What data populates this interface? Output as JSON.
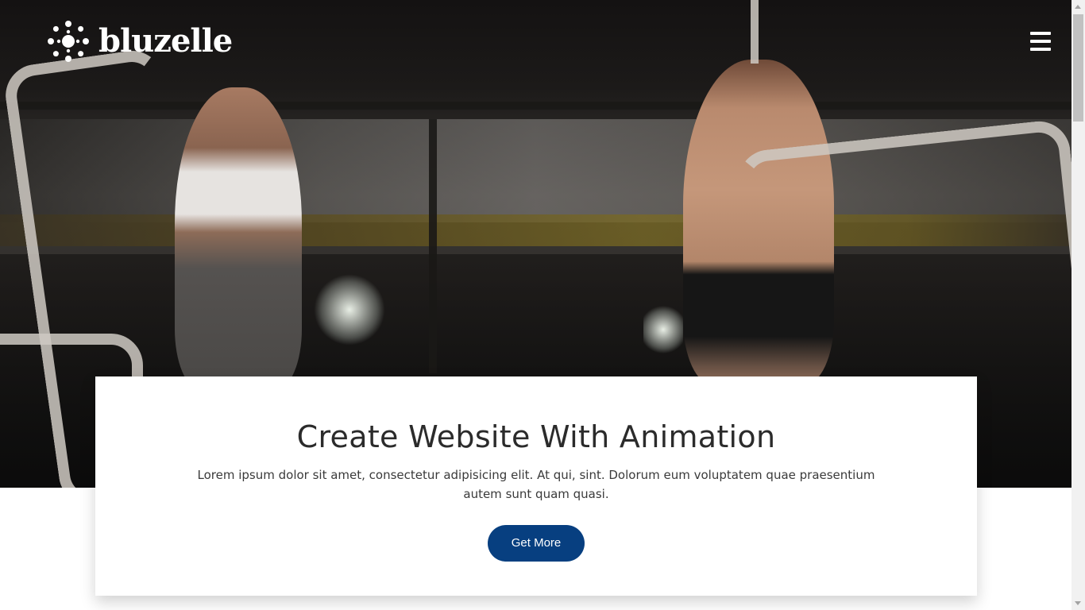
{
  "brand": {
    "name": "bluzelle",
    "logo_icon": "sunburst-dots-icon"
  },
  "header": {
    "menu_icon": "hamburger-menu-icon"
  },
  "hero": {
    "image_description_icon": "gym-photo"
  },
  "card": {
    "title": "Create Website With Animation",
    "body": "Lorem ipsum dolor sit amet, consectetur adipisicing elit. At qui, sint. Dolorum eum voluptatem quae praesentium autem sunt quam quasi.",
    "cta_label": "Get More"
  },
  "colors": {
    "cta_bg": "#073f80",
    "cta_text": "#ffffff",
    "logo_text": "#ffffff",
    "card_bg": "#ffffff",
    "heading": "#2b2b2b"
  }
}
